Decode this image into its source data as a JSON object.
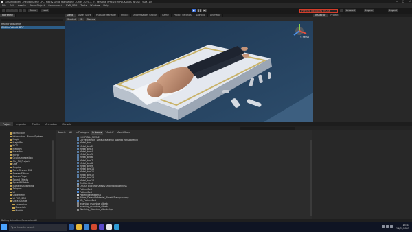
{
  "window": {
    "title": "GitSlimPatient - RealtorScene - PC, Mac & Linux Standalone - Unity 2020.3.7f1 Personal [PREVIEW PACKAGES IN USE] <DX11>",
    "controls": [
      "—",
      "□",
      "✕"
    ]
  },
  "menu": [
    "File",
    "Edit",
    "Assets",
    "GameObject",
    "Component",
    "PVR_SDK",
    "Tools",
    "Window",
    "Help"
  ],
  "toolbar": {
    "pivot": "Center",
    "space": "Local",
    "branch": "Preview Packages In Use",
    "account": "Account",
    "layers": "Layers",
    "layout": "Layout"
  },
  "panels": {
    "hierarchy_tab": "Hierarchy",
    "scene_tabs": [
      "Scene",
      "Asset Store",
      "Package Manager",
      "Project",
      "Addressables Groups",
      "Game",
      "Project Settings",
      "Lighting",
      "Animator"
    ],
    "inspector_tabs": [
      "Inspector",
      "Project"
    ]
  },
  "hierarchy": {
    "rows": [
      "RealtorBedScene",
      "GitSlimPatientHDRP"
    ]
  },
  "scene": {
    "toolbar": [
      "Shaded",
      "2D",
      "Gizmos"
    ],
    "view_label": "< Persp"
  },
  "bottom_tabs": [
    "Project",
    "Inspector",
    "Profiler",
    "Animation",
    "Console"
  ],
  "filter_tabs": [
    "Search:",
    "All",
    "In Packages",
    "In Assets",
    "'Models'",
    "Asset Store"
  ],
  "folders": [
    "Interaction",
    "Interaction - Focus System",
    "Magic",
    "MagicBin",
    "MCG",
    "Medium",
    "Metallics",
    "Mirror",
    "OculusIntegration",
    "Old_FX_Project",
    "OtM",
    "Graphs",
    "Save System 2.0",
    "Screen Effects",
    "ScreenPlayer",
    "Sound Effects",
    "SpeedFXPatch",
    "SurfaceShadowing",
    "Teleport",
    "UI",
    "UIElements",
    "UI PVR_SDK",
    "Ultra Sounds",
    "Animation",
    "Materials",
    "Models"
  ],
  "files": [
    "HOSPITAL_SCENE",
    "CurvedTerrain_DefaultMaterial_AlbedoTransparency",
    "Metal_bed",
    "Metal_bed2",
    "Metal_bed3",
    "Metal_bed4",
    "Metal_bed5",
    "Metal_bed6",
    "Metal_bed7",
    "Metal_bed8",
    "Metal_bed9",
    "Metal_bed10",
    "Metal_bed11",
    "Metal_bed12",
    "Metal_bed13",
    "Metal_bed14",
    "OldManTest",
    "OculusTouchForQuest2_AlbedoRoughness",
    "PatientBed",
    "PatientBed",
    "PatientBedMaterial",
    "Pillow_DefaultMaterial_AlbedoTransparency",
    "VR_PatientBed",
    "washing_machine_albedo",
    "washing_machine_albedo",
    "Washing_Machine_albedo.tga"
  ],
  "status": "Baking Animation Generation All",
  "taskbar": {
    "search": "Type here to search",
    "time": "15:43",
    "date": "19/05/2021"
  },
  "colors": {
    "accent": "#3c6fd8",
    "branch_warning": "#d43c2a",
    "selection": "#2c5d87",
    "folder": "#c8a550"
  }
}
